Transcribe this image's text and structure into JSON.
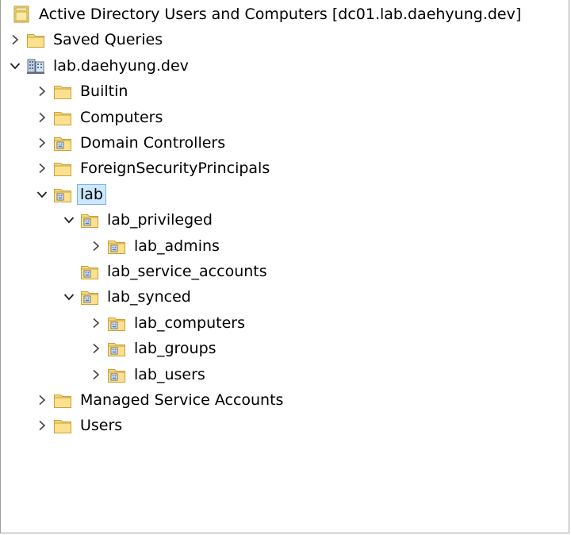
{
  "window": {
    "title": "Active Directory Users and Computers [dc01.lab.daehyung.dev]"
  },
  "tree": [
    {
      "label": "Active Directory Users and Computers [dc01.lab.daehyung.dev]",
      "level": 0,
      "expander": "none",
      "icon": "snapin",
      "name": "root"
    },
    {
      "label": "Saved Queries",
      "level": 1,
      "expander": "collapsed",
      "icon": "folder",
      "name": "saved-queries"
    },
    {
      "label": "lab.daehyung.dev",
      "level": 1,
      "expander": "expanded",
      "icon": "domain",
      "name": "domain"
    },
    {
      "label": "Builtin",
      "level": 2,
      "expander": "collapsed",
      "icon": "folder",
      "name": "builtin"
    },
    {
      "label": "Computers",
      "level": 2,
      "expander": "collapsed",
      "icon": "folder",
      "name": "computers"
    },
    {
      "label": "Domain Controllers",
      "level": 2,
      "expander": "collapsed",
      "icon": "ou",
      "name": "domain-controllers"
    },
    {
      "label": "ForeignSecurityPrincipals",
      "level": 2,
      "expander": "collapsed",
      "icon": "folder",
      "name": "foreign-security-principals"
    },
    {
      "label": "lab",
      "level": 2,
      "expander": "expanded",
      "icon": "ou",
      "name": "lab",
      "selected": true
    },
    {
      "label": "lab_privileged",
      "level": 3,
      "expander": "expanded",
      "icon": "ou",
      "name": "lab-privileged"
    },
    {
      "label": "lab_admins",
      "level": 4,
      "expander": "collapsed",
      "icon": "ou",
      "name": "lab-admins"
    },
    {
      "label": "lab_service_accounts",
      "level": 3,
      "expander": "none",
      "icon": "ou",
      "name": "lab-service-accounts"
    },
    {
      "label": "lab_synced",
      "level": 3,
      "expander": "expanded",
      "icon": "ou",
      "name": "lab-synced"
    },
    {
      "label": "lab_computers",
      "level": 4,
      "expander": "collapsed",
      "icon": "ou",
      "name": "lab-computers"
    },
    {
      "label": "lab_groups",
      "level": 4,
      "expander": "collapsed",
      "icon": "ou",
      "name": "lab-groups"
    },
    {
      "label": "lab_users",
      "level": 4,
      "expander": "collapsed",
      "icon": "ou",
      "name": "lab-users"
    },
    {
      "label": "Managed Service Accounts",
      "level": 2,
      "expander": "collapsed",
      "icon": "folder",
      "name": "managed-service-accounts"
    },
    {
      "label": "Users",
      "level": 2,
      "expander": "collapsed",
      "icon": "folder",
      "name": "users"
    }
  ],
  "colors": {
    "selection_bg": "#cce8ff",
    "selection_border": "#7ab2e6",
    "folder_fill": "#f7d774",
    "folder_edge": "#c9a13b"
  }
}
